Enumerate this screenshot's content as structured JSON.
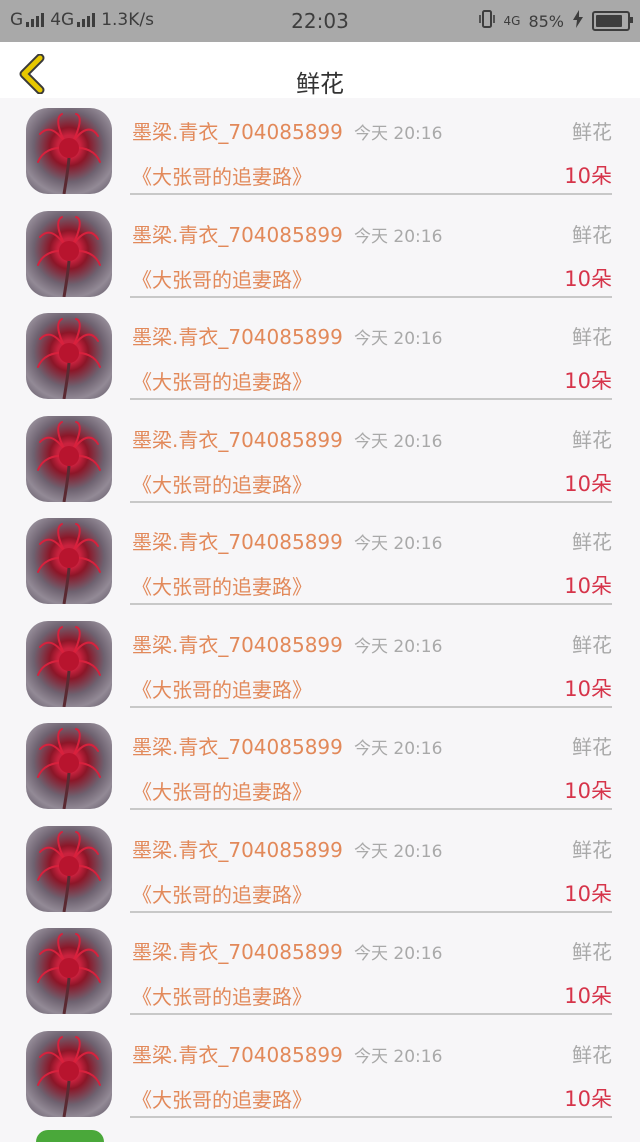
{
  "status_bar": {
    "carrier": "G",
    "network": "4G",
    "speed": "1.3K/s",
    "time": "22:03",
    "data_type": "4G",
    "battery": "85%",
    "battery_level": 0.85
  },
  "header": {
    "title": "鲜花"
  },
  "list": {
    "items": [
      {
        "name": "墨梁.青衣_704085899",
        "time": "今天 20:16",
        "gift": "鲜花",
        "book": "《大张哥的追妻路》",
        "count": "10朵"
      },
      {
        "name": "墨梁.青衣_704085899",
        "time": "今天 20:16",
        "gift": "鲜花",
        "book": "《大张哥的追妻路》",
        "count": "10朵"
      },
      {
        "name": "墨梁.青衣_704085899",
        "time": "今天 20:16",
        "gift": "鲜花",
        "book": "《大张哥的追妻路》",
        "count": "10朵"
      },
      {
        "name": "墨梁.青衣_704085899",
        "time": "今天 20:16",
        "gift": "鲜花",
        "book": "《大张哥的追妻路》",
        "count": "10朵"
      },
      {
        "name": "墨梁.青衣_704085899",
        "time": "今天 20:16",
        "gift": "鲜花",
        "book": "《大张哥的追妻路》",
        "count": "10朵"
      },
      {
        "name": "墨梁.青衣_704085899",
        "time": "今天 20:16",
        "gift": "鲜花",
        "book": "《大张哥的追妻路》",
        "count": "10朵"
      },
      {
        "name": "墨梁.青衣_704085899",
        "time": "今天 20:16",
        "gift": "鲜花",
        "book": "《大张哥的追妻路》",
        "count": "10朵"
      },
      {
        "name": "墨梁.青衣_704085899",
        "time": "今天 20:16",
        "gift": "鲜花",
        "book": "《大张哥的追妻路》",
        "count": "10朵"
      },
      {
        "name": "墨梁.青衣_704085899",
        "time": "今天 20:16",
        "gift": "鲜花",
        "book": "《大张哥的追妻路》",
        "count": "10朵"
      },
      {
        "name": "墨梁.青衣_704085899",
        "time": "今天 20:16",
        "gift": "鲜花",
        "book": "《大张哥的追妻路》",
        "count": "10朵"
      }
    ]
  },
  "colors": {
    "name_text": "#e2895a",
    "count_text": "#d6344a",
    "meta_text": "#a9a9a9",
    "back_icon": "#e6c800"
  },
  "icons": {
    "back": "chevron-left-icon",
    "vibrate": "vibrate-icon",
    "charging": "charging-bolt-icon",
    "battery": "battery-icon"
  }
}
